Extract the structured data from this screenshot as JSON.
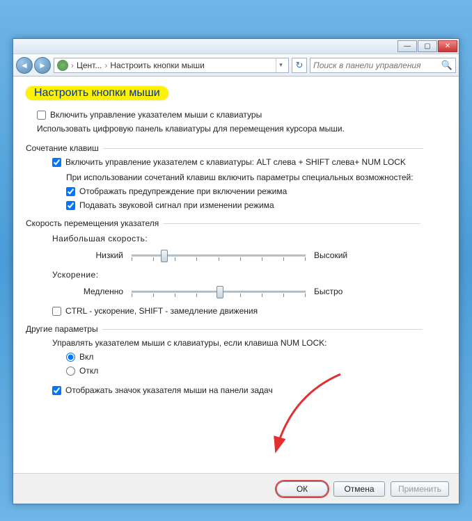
{
  "titlebar": {
    "minimize": "—",
    "maximize": "▢",
    "close": "✕"
  },
  "breadcrumb": {
    "part1": "Цент...",
    "part2": "Настроить кнопки мыши",
    "sep": "›"
  },
  "search": {
    "placeholder": "Поиск в панели управления"
  },
  "page": {
    "title": "Настроить кнопки мыши"
  },
  "main_checkbox": {
    "label": "Включить управление указателем мыши с клавиатуры",
    "checked": false
  },
  "main_desc": "Использовать цифровую панель клавиатуры для перемещения курсора мыши.",
  "group1": {
    "label": "Сочетание клавиш",
    "enable": {
      "label": "Включить управление указателем с клавиатуры: ALT слева + SHIFT слева+ NUM LOCK",
      "checked": true
    },
    "desc": "При использовании сочетаний клавиш включить параметры специальных возможностей:",
    "warn": {
      "label": "Отображать предупреждение при включении режима",
      "checked": true
    },
    "sound": {
      "label": "Подавать звуковой сигнал при изменении режима",
      "checked": true
    }
  },
  "group2": {
    "label": "Скорость перемещения указателя",
    "speed_label": "Наибольшая скорость:",
    "speed_low": "Низкий",
    "speed_high": "Высокий",
    "accel_label": "Ускорение:",
    "accel_low": "Медленно",
    "accel_high": "Быстро",
    "ctrl_shift": {
      "label": "CTRL - ускорение, SHIFT - замедление движения",
      "checked": false
    }
  },
  "group3": {
    "label": "Другие параметры",
    "desc": "Управлять указателем мыши с клавиатуры, если клавиша NUM LOCK:",
    "radio_on": "Вкл",
    "radio_off": "Откл",
    "radio_value": "on",
    "tray": {
      "label": "Отображать значок указателя мыши на панели задач",
      "checked": true
    }
  },
  "footer": {
    "ok": "ОК",
    "cancel": "Отмена",
    "apply": "Применить"
  }
}
